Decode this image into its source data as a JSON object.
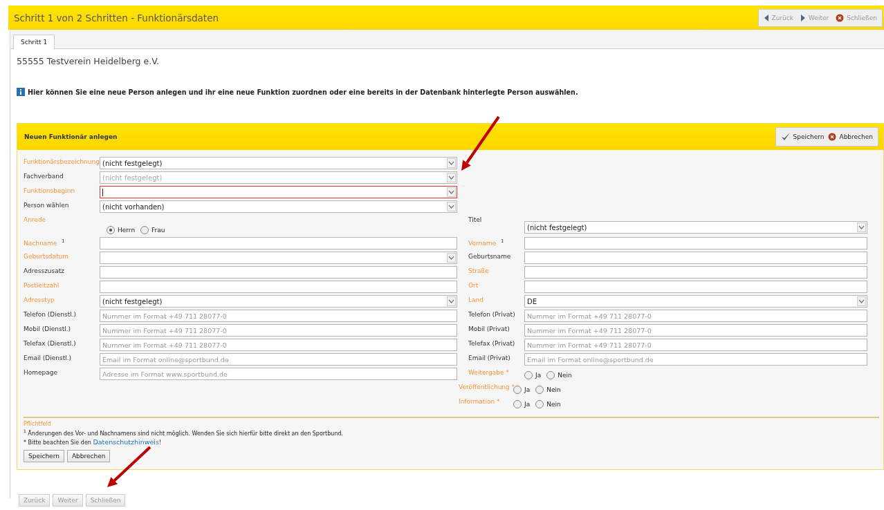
{
  "window": {
    "title": "Schritt 1 von 2 Schritten - Funktionärsdaten"
  },
  "nav_buttons": [
    {
      "label": "Zurück",
      "kind": "back",
      "disabled": true
    },
    {
      "label": "Weiter",
      "kind": "forward",
      "disabled": true
    },
    {
      "label": "Schließen",
      "kind": "close",
      "disabled": true
    }
  ],
  "tabs": [
    {
      "label": "Schritt 1",
      "selected": true
    }
  ],
  "club_name": "55555 Testverein Heidelberg e.V.",
  "info": "Hier können Sie eine neue Person anlegen und ihr eine neue Funktion zuordnen oder eine bereits in der Datenbank hinterlegte Person auswählen.",
  "form": {
    "title": "Neuen Funktionär anlegen",
    "header_buttons": [
      {
        "label": "Speichern",
        "kind": "save"
      },
      {
        "label": "Abbrechen",
        "kind": "cancel"
      }
    ],
    "rows": [
      {
        "left": {
          "label": "Funktionärsbezeichnung",
          "required": true,
          "kind": "select",
          "value": "(nicht festgelegt)"
        }
      },
      {
        "left": {
          "label": "Fachverband",
          "required": false,
          "kind": "select",
          "value": "(nicht festgelegt)",
          "disabled": true,
          "pointed_at": true
        }
      },
      {
        "left": {
          "label": "Funktionsbeginn",
          "required": true,
          "kind": "select",
          "invalid": true,
          "focused": true
        }
      },
      {
        "left": {
          "label": "Person wählen",
          "required": false,
          "kind": "select",
          "value": "(nicht vorhanden)"
        }
      },
      {
        "left": {
          "label": "Anrede",
          "required": true,
          "kind": "radio",
          "options": [
            {
              "label": "Herrn",
              "selected": true
            },
            {
              "label": "Frau",
              "selected": false
            }
          ]
        },
        "right": {
          "label": "Titel",
          "required": false,
          "kind": "select",
          "value": "(nicht festgelegt)"
        }
      },
      {
        "left": {
          "label": "Nachname $^{1}$",
          "required": true,
          "kind": "text"
        },
        "right": {
          "label": "Vorname $^{1}$",
          "required": true,
          "kind": "text"
        }
      },
      {
        "left": {
          "label": "Geburtsdatum",
          "required": true,
          "kind": "select"
        },
        "right": {
          "label": "Geburtsname",
          "required": false,
          "kind": "text"
        }
      },
      {
        "left": {
          "label": "Adresszusatz",
          "required": false,
          "kind": "text"
        },
        "right": {
          "label": "Straße",
          "required": true,
          "kind": "text"
        }
      },
      {
        "left": {
          "label": "Postleitzahl",
          "required": true,
          "kind": "text"
        },
        "right": {
          "label": "Ort",
          "required": true,
          "kind": "text"
        }
      },
      {
        "left": {
          "label": "Adresstyp",
          "required": true,
          "kind": "select",
          "value": "(nicht festgelegt)"
        },
        "right": {
          "label": "Land",
          "required": true,
          "kind": "select",
          "value": "DE"
        }
      },
      {
        "left": {
          "label": "Telefon (Dienstl.)",
          "required": false,
          "kind": "text",
          "placeholder": "Nummer im Format +49 711 28077-0"
        },
        "right": {
          "label": "Telefon (Privat)",
          "required": false,
          "kind": "text",
          "placeholder": "Nummer im Format +49 711 28077-0"
        }
      },
      {
        "left": {
          "label": "Mobil (Dienstl.)",
          "required": false,
          "kind": "text",
          "placeholder": "Nummer im Format +49 711 28077-0"
        },
        "right": {
          "label": "Mobil (Privat)",
          "required": false,
          "kind": "text",
          "placeholder": "Nummer im Format +49 711 28077-0"
        }
      },
      {
        "left": {
          "label": "Telefax (Dienstl.)",
          "required": false,
          "kind": "text",
          "placeholder": "Nummer im Format +49 711 28077-0"
        },
        "right": {
          "label": "Telefax (Privat)",
          "required": false,
          "kind": "text",
          "placeholder": "Nummer im Format +49 711 28077-0"
        }
      },
      {
        "left": {
          "label": "Email (Dienstl.)",
          "required": false,
          "kind": "text",
          "placeholder": "Email im Format online@sportbund.de"
        },
        "right": {
          "label": "Email (Privat)",
          "required": false,
          "kind": "text",
          "placeholder": "Email im Format online@sportbund.de"
        }
      },
      {
        "left": {
          "label": "Homepage",
          "required": false,
          "kind": "text",
          "placeholder": "Adresse im Format www.sportbund.de"
        },
        "right": {
          "label": "Weitergabe *",
          "required": true,
          "kind": "radio",
          "options": [
            {
              "label": "Ja",
              "selected": false
            },
            {
              "label": "Nein",
              "selected": false
            }
          ]
        }
      },
      {
        "right": {
          "label": "Veröffentlichung *",
          "required": true,
          "kind": "radio",
          "options": [
            {
              "label": "Ja",
              "selected": false
            },
            {
              "label": "Nein",
              "selected": false
            }
          ]
        }
      },
      {
        "right": {
          "label": "Information *",
          "required": true,
          "kind": "radio",
          "options": [
            {
              "label": "Ja",
              "selected": false
            },
            {
              "label": "Nein",
              "selected": false
            }
          ]
        }
      }
    ],
    "required_legend": "Pflichtfeld",
    "footnote": "$^{1}$ Änderungen des Vor- und Nachnamens sind nicht möglich. Wenden Sie sich hierfür bitte direkt an den Sportbund.",
    "privacy_text": "* Bitte beachten Sie den ",
    "privacy_link": "Datenschutzhinweis",
    "privacy_suffix": "!",
    "buttons": [
      {
        "label": "Speichern"
      },
      {
        "label": "Abbrechen"
      }
    ]
  },
  "footer_buttons": [
    {
      "label": "Zurück",
      "disabled": true
    },
    {
      "label": "Weiter",
      "disabled": true
    },
    {
      "label": "Schließen",
      "disabled": true,
      "pointed_at": true
    }
  ]
}
